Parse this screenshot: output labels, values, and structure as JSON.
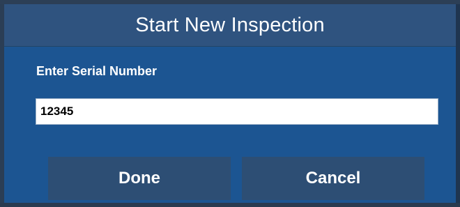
{
  "dialog": {
    "title": "Start New Inspection",
    "field_label": "Enter Serial Number",
    "serial_value": "12345",
    "done_label": "Done",
    "cancel_label": "Cancel"
  },
  "colors": {
    "dialog_body": "#1c5592",
    "title_bar": "#2f537f",
    "button": "#2d4e74",
    "frame": "#2b3e55",
    "text": "#ffffff"
  }
}
